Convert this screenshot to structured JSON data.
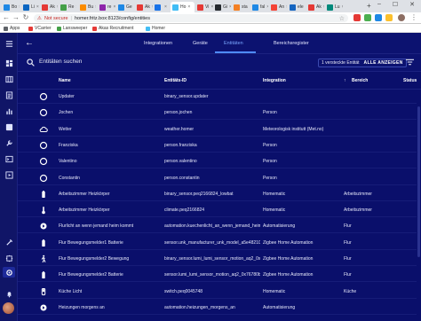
{
  "browser": {
    "tabs": [
      {
        "label": "Bo",
        "color": "#1e88e5"
      },
      {
        "label": "Li",
        "color": "#0a66c2"
      },
      {
        "label": "Ak",
        "color": "#e53935"
      },
      {
        "label": "Re",
        "color": "#43a047"
      },
      {
        "label": "Bu",
        "color": "#fb8c00"
      },
      {
        "label": "re",
        "color": "#8e24aa"
      },
      {
        "label": "Ge",
        "color": "#1e88e5"
      },
      {
        "label": "Ak",
        "color": "#e53935"
      },
      {
        "label": "",
        "color": "#1a73e8"
      },
      {
        "label": "Ho",
        "color": "#41bdf5",
        "active": true
      },
      {
        "label": "Vi",
        "color": "#e53935"
      },
      {
        "label": "Gi",
        "color": "#24292e"
      },
      {
        "label": "sta",
        "color": "#f48024"
      },
      {
        "label": "fal",
        "color": "#1e88e5"
      },
      {
        "label": "An",
        "color": "#f44336"
      },
      {
        "label": "ele",
        "color": "#1565c0"
      },
      {
        "label": "Ak",
        "color": "#e53935"
      },
      {
        "label": "Lu",
        "color": "#00897b"
      }
    ],
    "address": {
      "security": "Not secure",
      "url": "homer.fritz.box:8123/config/entities"
    },
    "bookmarks": [
      {
        "label": "Apps",
        "color": "#5f6368"
      },
      {
        "label": "VCarrier",
        "color": "#e53935"
      },
      {
        "label": "Lansweeper",
        "color": "#43a047"
      },
      {
        "label": "Akas Recruitment",
        "color": "#e53935"
      },
      {
        "label": "Homer",
        "color": "#41bdf5"
      }
    ]
  },
  "nav": {
    "tabs": [
      {
        "key": "integrations",
        "label": "Integrationen"
      },
      {
        "key": "devices",
        "label": "Geräte"
      },
      {
        "key": "entities",
        "label": "Entitäten"
      },
      {
        "key": "areas",
        "label": "Bereichsregister"
      }
    ]
  },
  "search": {
    "placeholder": "Entitäten suchen",
    "hidden_text": "1 versteckte Entität",
    "show_label": "ALLE ANZEIGEN"
  },
  "table": {
    "columns": {
      "name": "Name",
      "entity_id": "Entitäts-ID",
      "integration": "Integration",
      "area": "Bereich",
      "status": "Status"
    },
    "rows": [
      {
        "icon": "update-icon",
        "name": "Updater",
        "entity_id": "binary_sensor.updater",
        "integration": "",
        "area": ""
      },
      {
        "icon": "person-icon",
        "name": "Jochen",
        "entity_id": "person.jochen",
        "integration": "Person",
        "area": ""
      },
      {
        "icon": "weather-icon",
        "name": "Wetter",
        "entity_id": "weather.homer",
        "integration": "Meteorologisk institutt (Met.no)",
        "area": ""
      },
      {
        "icon": "person-icon",
        "name": "Franziska",
        "entity_id": "person.franziska",
        "integration": "Person",
        "area": ""
      },
      {
        "icon": "person-icon",
        "name": "Valentino",
        "entity_id": "person.valentino",
        "integration": "Person",
        "area": ""
      },
      {
        "icon": "person-icon",
        "name": "Constantin",
        "entity_id": "person.constantin",
        "integration": "Person",
        "area": ""
      },
      {
        "icon": "battery-icon",
        "name": "Arbeitszimmer Heizkörper",
        "entity_id": "binary_sensor.peq2166824_lowbat",
        "integration": "Homematic",
        "area": "Arbeitszimmer"
      },
      {
        "icon": "thermostat-icon",
        "name": "Arbeitszimmer Heizkörper",
        "entity_id": "climate.peq2166824",
        "integration": "Homematic",
        "area": "Arbeitszimmer"
      },
      {
        "icon": "automation-icon",
        "name": "Flurlicht an wenn jemand heim kommt",
        "entity_id": "automation.kuechenlicht_an_wenn_jemand_heim_kommt",
        "integration": "Automatisierung",
        "area": "Flur"
      },
      {
        "icon": "battery-icon",
        "name": "Flur Bewegungsmelder1 Batterie",
        "entity_id": "sensor.unk_manufacturer_unk_model_a5e4821044_...",
        "integration": "Zigbee Home Automation",
        "area": "Flur"
      },
      {
        "icon": "motion-icon",
        "name": "Flur Bewegungsmelder2 Bewegung",
        "entity_id": "binary_sensor.lumi_lumi_sensor_motion_aq2_0x...",
        "integration": "Zigbee Home Automation",
        "area": "Flur"
      },
      {
        "icon": "battery-icon",
        "name": "Flur Bewegungsmelder2 Batterie",
        "entity_id": "sensor.lumi_lumi_sensor_motion_aq2_0x76780b...",
        "integration": "Zigbee Home Automation",
        "area": "Flur"
      },
      {
        "icon": "switch-icon",
        "name": "Küche Licht",
        "entity_id": "switch.peq0045748",
        "integration": "Homematic",
        "area": "Küche"
      },
      {
        "icon": "automation-icon",
        "name": "Heizungen morgens an",
        "entity_id": "automation.heizungen_morgens_an",
        "integration": "Automatisierung",
        "area": ""
      }
    ]
  }
}
